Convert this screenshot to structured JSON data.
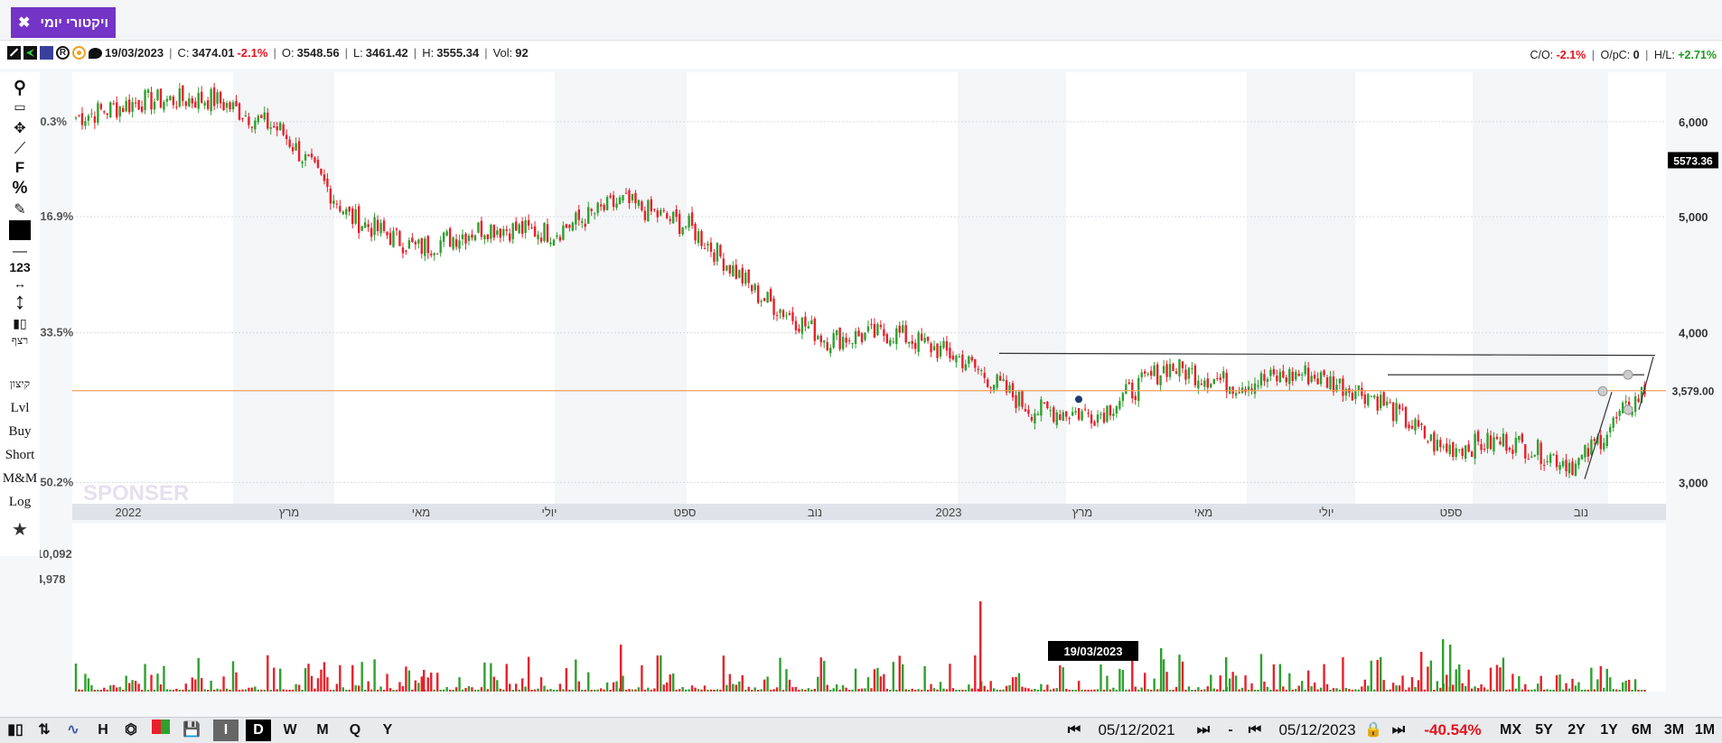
{
  "tab": {
    "label": "ויקטורי יומי",
    "close": "✖"
  },
  "info": {
    "date": "19/03/2023",
    "c_label": "C:",
    "c_value": "3474.01",
    "c_change": "-2.1%",
    "o_label": "O:",
    "o_value": "3548.56",
    "l_label": "L:",
    "l_value": "3461.42",
    "h_label": "H:",
    "h_value": "3555.34",
    "vol_label": "Vol:",
    "vol_value": "92",
    "co_label": "C/O:",
    "co_value": "-2.1%",
    "opc_label": "O/pC:",
    "opc_value": "0",
    "hl_label": "H/L:",
    "hl_value": "+2.71%"
  },
  "tools": [
    "Lvl",
    "Buy",
    "Short",
    "M&M",
    "Log",
    "קיצון",
    "רצף",
    "123",
    "F",
    "%"
  ],
  "chart_data": {
    "type": "candlestick",
    "colors": {
      "up": "#2ea02e",
      "down": "#e8202a",
      "hline": "#f0a060",
      "trend": "#333333"
    },
    "x_tick_labels": [
      "2022",
      "מרץ",
      "מאי",
      "יולי",
      "ספט",
      "נוב",
      "2023",
      "מרץ",
      "מאי",
      "יולי",
      "ספט",
      "נוב"
    ],
    "right_axis_labels": [
      "6,000",
      "5,000",
      "4,000",
      "3,000"
    ],
    "left_axis_labels": [
      "-0.3%",
      "-16.9%",
      "-33.5%",
      "-50.2%"
    ],
    "price_tag": "5573.36",
    "last_price_tag": "3,579.00",
    "volume_labels": [
      "10,092",
      "4,978"
    ],
    "crosshair_date": "19/03/2023",
    "watermark": "SPONSER",
    "price_series": [
      {
        "month": "2022-01",
        "price": 6050
      },
      {
        "month": "2022-02",
        "price": 6250
      },
      {
        "month": "2022-03",
        "price": 6270
      },
      {
        "month": "2022-04",
        "price": 5900
      },
      {
        "month": "2022-05",
        "price": 5000
      },
      {
        "month": "2022-06",
        "price": 4700
      },
      {
        "month": "2022-07",
        "price": 4900
      },
      {
        "month": "2022-08",
        "price": 4850
      },
      {
        "month": "2022-09",
        "price": 5150
      },
      {
        "month": "2022-10",
        "price": 4900
      },
      {
        "month": "2022-11",
        "price": 4300
      },
      {
        "month": "2022-12",
        "price": 3950
      },
      {
        "month": "2023-01",
        "price": 4000
      },
      {
        "month": "2023-02",
        "price": 3800
      },
      {
        "month": "2023-03",
        "price": 3450
      },
      {
        "month": "2023-04",
        "price": 3420
      },
      {
        "month": "2023-05",
        "price": 3750
      },
      {
        "month": "2023-06",
        "price": 3620
      },
      {
        "month": "2023-07",
        "price": 3700
      },
      {
        "month": "2023-08",
        "price": 3550
      },
      {
        "month": "2023-09",
        "price": 3200
      },
      {
        "month": "2023-10",
        "price": 3250
      },
      {
        "month": "2023-11",
        "price": 3100
      },
      {
        "month": "2023-12",
        "price": 3579
      }
    ]
  },
  "bottom": {
    "range_start": "05/12/2021",
    "range_end": "05/12/2023",
    "range_dash": "-",
    "change": "-40.54%",
    "intervals": [
      "I",
      "D",
      "W",
      "M",
      "Q",
      "Y"
    ],
    "periods": [
      "MX",
      "5Y",
      "2Y",
      "1Y",
      "6M",
      "3M",
      "1M"
    ]
  }
}
